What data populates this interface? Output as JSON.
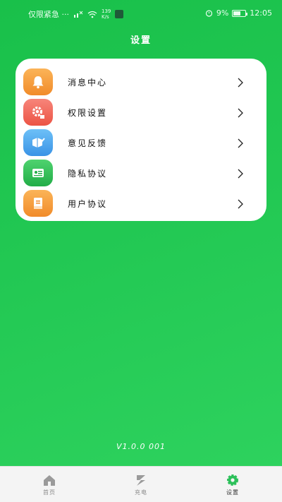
{
  "status_bar": {
    "carrier": "仅限紧急 ···",
    "speed_value": "139",
    "speed_unit": "K/s",
    "signal_text": "9%",
    "time": "12:05",
    "battery_level": 0.6
  },
  "header": {
    "title": "设置"
  },
  "menu": {
    "items": [
      {
        "label": "消息中心",
        "icon": "bell-icon",
        "color": "#f59b3a"
      },
      {
        "label": "权限设置",
        "icon": "gear-icon",
        "color": "#f26a5c"
      },
      {
        "label": "意见反馈",
        "icon": "feedback-icon",
        "color": "#4aa9ef"
      },
      {
        "label": "隐私协议",
        "icon": "privacy-icon",
        "color": "#34c05a"
      },
      {
        "label": "用户协议",
        "icon": "document-icon",
        "color": "#f59b3a"
      }
    ]
  },
  "footer": {
    "version": "V1.0.0 001"
  },
  "tabs": [
    {
      "label": "首页",
      "icon": "home-icon",
      "active": false
    },
    {
      "label": "充电",
      "icon": "charge-icon",
      "active": false
    },
    {
      "label": "设置",
      "icon": "settings-icon",
      "active": true
    }
  ],
  "colors": {
    "background_start": "#19c04a",
    "background_end": "#2fd35f",
    "active_tab": "#2cc05a"
  }
}
